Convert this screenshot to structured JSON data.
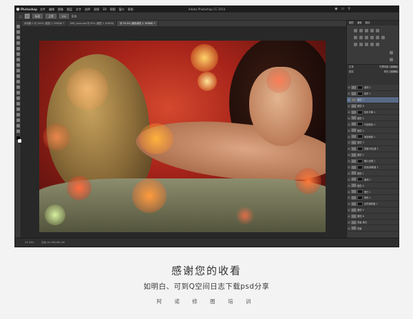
{
  "window": {
    "app_name": "Photoshop",
    "title": "Adobe Photoshop CC 2014",
    "menus": [
      "文件",
      "编辑",
      "图像",
      "图层",
      "文字",
      "选择",
      "滤镜",
      "3D",
      "视图",
      "窗口",
      "帮助"
    ]
  },
  "options_bar": {
    "preset": "标准",
    "field1": "0%",
    "field2": "",
    "field3": "",
    "label1": "正常",
    "label2": "反向"
  },
  "tabs": [
    {
      "label": "未标题-1 @ 100% (图层 1, RGB/8) *",
      "active": false
    },
    {
      "label": "IMG_xxxx.psd @ 50% (图层 1, RGB/8)",
      "active": false
    },
    {
      "label": "@ 33.3% (颜色填充 1, RGB/8) *",
      "active": true
    }
  ],
  "panels": {
    "tabs": [
      "图层",
      "通道",
      "路径"
    ],
    "blend_mode": "正常",
    "opacity_label": "不透明度",
    "opacity_value": "100%",
    "lock_label": "锁定",
    "fill_label": "填充",
    "fill_value": "100%"
  },
  "layers": [
    {
      "name": "曲线 1",
      "mask": true,
      "selected": false
    },
    {
      "name": "色阶 1",
      "mask": true,
      "selected": false
    },
    {
      "name": "图层 7",
      "mask": false,
      "selected": true
    },
    {
      "name": "图层 6",
      "mask": false,
      "selected": false
    },
    {
      "name": "色彩平衡 1",
      "mask": true,
      "selected": false
    },
    {
      "name": "图层 5",
      "mask": false,
      "selected": false
    },
    {
      "name": "可选颜色 1",
      "mask": true,
      "selected": false
    },
    {
      "name": "图层 4",
      "mask": false,
      "selected": false
    },
    {
      "name": "渐变映射 1",
      "mask": true,
      "selected": false
    },
    {
      "name": "图层 3",
      "mask": false,
      "selected": false
    },
    {
      "name": "亮度/对比度 1",
      "mask": true,
      "selected": false
    },
    {
      "name": "图层 2",
      "mask": false,
      "selected": false
    },
    {
      "name": "照片滤镜 1",
      "mask": true,
      "selected": false
    },
    {
      "name": "色相/饱和度 1",
      "mask": true,
      "selected": false
    },
    {
      "name": "图层 1",
      "mask": false,
      "selected": false
    },
    {
      "name": "曲线 2",
      "mask": true,
      "selected": false
    },
    {
      "name": "图层 0",
      "mask": false,
      "selected": false
    },
    {
      "name": "黑白 1",
      "mask": true,
      "selected": false
    },
    {
      "name": "纯色 1",
      "mask": true,
      "selected": false
    },
    {
      "name": "自然饱和度 1",
      "mask": true,
      "selected": false
    },
    {
      "name": "图层 9",
      "mask": false,
      "selected": false
    },
    {
      "name": "图层 8",
      "mask": false,
      "selected": false
    },
    {
      "name": "背景 拷贝",
      "mask": false,
      "selected": false
    },
    {
      "name": "背景",
      "mask": false,
      "selected": false
    }
  ],
  "status": {
    "zoom": "33.33%",
    "doc": "文档:16.7M/160.3M"
  },
  "caption": {
    "title": "感谢您的收看",
    "subtitle": "如明白、可到Q空间日志下载psd分享",
    "brand": "阿 诺 修 图 培 训"
  },
  "colors": {
    "window_bg": "#2b2b2b",
    "selected_layer": "#586a86",
    "page_bg": "#f3f3f3"
  }
}
